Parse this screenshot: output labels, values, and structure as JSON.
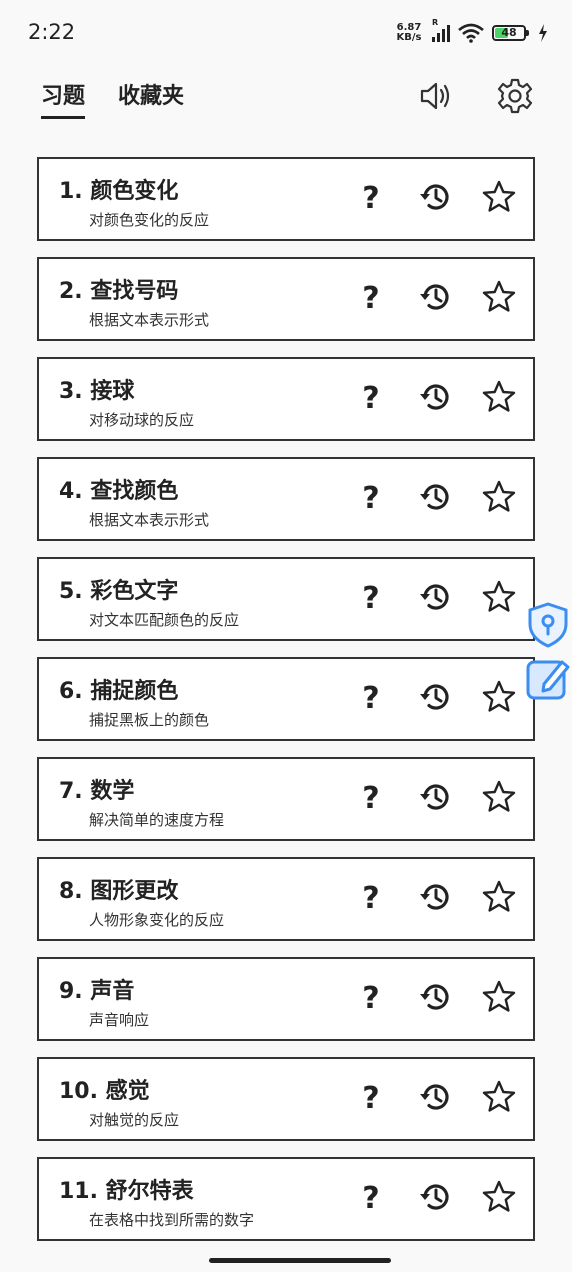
{
  "status": {
    "time": "2:22",
    "net_speed_value": "6.87",
    "net_speed_unit": "KB/s",
    "net_indicator": "R",
    "battery": "48",
    "battery_level": 0.48
  },
  "tabs": [
    {
      "label": "习题",
      "active": true
    },
    {
      "label": "收藏夹",
      "active": false
    }
  ],
  "icons": {
    "sound": "speaker-icon",
    "settings": "gear-icon",
    "help": "question-icon",
    "history": "history-icon",
    "favorite": "star-icon"
  },
  "exercises": [
    {
      "title": "1. 颜色变化",
      "subtitle": "对颜色变化的反应"
    },
    {
      "title": "2. 查找号码",
      "subtitle": "根据文本表示形式"
    },
    {
      "title": "3. 接球",
      "subtitle": "对移动球的反应"
    },
    {
      "title": "4. 查找颜色",
      "subtitle": "根据文本表示形式"
    },
    {
      "title": "5. 彩色文字",
      "subtitle": "对文本匹配颜色的反应"
    },
    {
      "title": "6. 捕捉颜色",
      "subtitle": "捕捉黑板上的颜色"
    },
    {
      "title": "7. 数学",
      "subtitle": "解决简单的速度方程"
    },
    {
      "title": "8. 图形更改",
      "subtitle": "人物形象变化的反应"
    },
    {
      "title": "9. 声音",
      "subtitle": "声音响应"
    },
    {
      "title": "10. 感觉",
      "subtitle": "对触觉的反应"
    },
    {
      "title": "11. 舒尔特表",
      "subtitle": "在表格中找到所需的数字"
    }
  ],
  "colors": {
    "background": "#f9f9f9",
    "card_border": "#333333",
    "text": "#222222",
    "side_widget": "#3b8ef0",
    "battery_fill": "#4cd36a"
  }
}
